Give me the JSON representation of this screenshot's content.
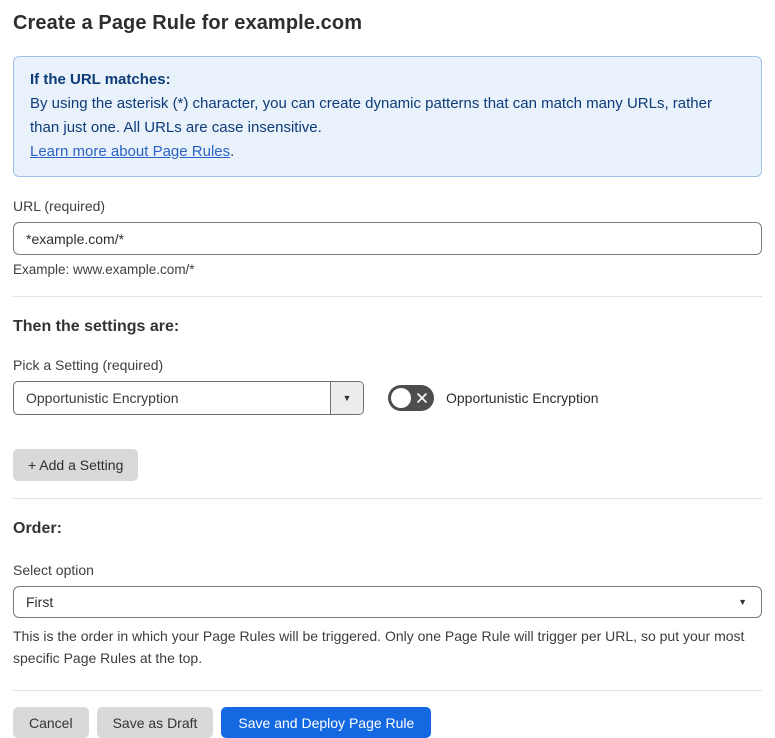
{
  "page": {
    "title": "Create a Page Rule for example.com"
  },
  "info_box": {
    "heading": "If the URL matches:",
    "body": "By using the asterisk (*) character, you can create dynamic patterns that can match many URLs, rather than just one. All URLs are case insensitive.",
    "link": "Learn more about Page Rules",
    "link_suffix": "."
  },
  "url_field": {
    "label": "URL (required)",
    "value": "*example.com/*",
    "helper": "Example: www.example.com/*"
  },
  "settings": {
    "heading": "Then the settings are:",
    "pick_label": "Pick a Setting (required)",
    "selected_setting": "Opportunistic Encryption",
    "toggle_label": "Opportunistic Encryption",
    "toggle_state": "off",
    "add_button": "+ Add a Setting"
  },
  "order": {
    "heading": "Order:",
    "label": "Select option",
    "selected": "First",
    "helper": "This is the order in which your Page Rules will be triggered. Only one Page Rule will trigger per URL, so put your most specific Page Rules at the top."
  },
  "actions": {
    "cancel": "Cancel",
    "save_draft": "Save as Draft",
    "save_deploy": "Save and Deploy Page Rule"
  },
  "icons": {
    "dropdown_arrow": "▼",
    "select_arrow": "▼"
  },
  "colors": {
    "info_bg": "#e9f1fb",
    "info_border": "#9fc2e8",
    "info_text": "#0d3c78",
    "link_blue": "#2c63c7",
    "primary_blue": "#1469e3",
    "toggle_off_gray": "#4d4d4d",
    "button_gray": "#d9d9d9"
  }
}
